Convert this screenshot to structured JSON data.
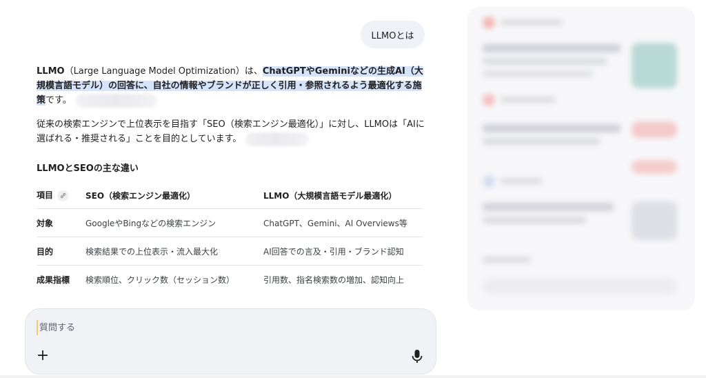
{
  "user_query": "LLMOとは",
  "answer": {
    "p1_lead": "LLMO",
    "p1_paren": "（Large Language Model Optimization）は、",
    "p1_highlight_a": "ChatGPTやGeminiなどの生成AI（大規模言語モデル）の回答に、自社の情報やブランドが正しく引用・参照されるよう最適化する",
    "p1_highlight_b": "施策",
    "p1_end": "です。",
    "p2": "従来の検索エンジンで上位表示を目指す「SEO（検索エンジン最適化）」に対し、LLMOは「AIに選ばれる・推奨される」ことを目的としています。"
  },
  "section_title": "LLMOとSEOの主な違い",
  "table": {
    "headers": [
      "項目",
      "SEO（検索エンジン最適化）",
      "LLMO（大規模言語モデル最適化）"
    ],
    "rows": [
      [
        "対象",
        "GoogleやBingなどの検索エンジン",
        "ChatGPT、Gemini、AI Overviews等"
      ],
      [
        "目的",
        "検索結果での上位表示・流入最大化",
        "AI回答での言及・引用・ブランド認知"
      ],
      [
        "成果指標",
        "検索順位、クリック数（セッション数）",
        "引用数、指名検索数の増加、認知向上"
      ]
    ]
  },
  "composer": {
    "placeholder": "質問する",
    "value": ""
  },
  "icons": {
    "add": "plus-icon",
    "mic": "microphone-icon",
    "link": "link-icon"
  },
  "colors": {
    "highlight": "#d5e3fb",
    "bubble": "#eef1f6",
    "composer": "#f0f2f6"
  }
}
